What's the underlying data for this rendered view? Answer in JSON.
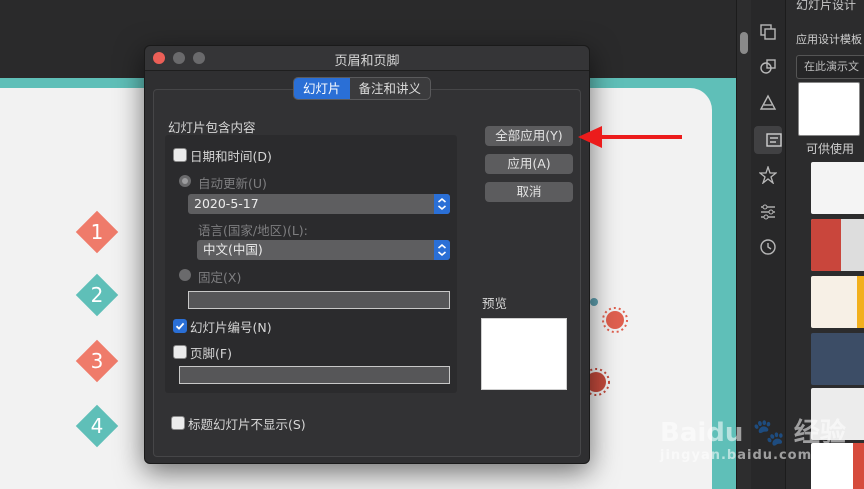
{
  "dialog": {
    "title": "页眉和页脚",
    "tabs": [
      "幻灯片",
      "备注和讲义"
    ],
    "section_title": "幻灯片包含内容",
    "date_time_label": "日期和时间(D)",
    "auto_update_label": "自动更新(U)",
    "date_value": "2020-5-17",
    "language_label": "语言(国家/地区)(L):",
    "language_value": "中文(中国)",
    "fixed_label": "固定(X)",
    "slide_number_label": "幻灯片编号(N)",
    "footer_label": "页脚(F)",
    "hide_on_title_label": "标题幻灯片不显示(S)",
    "buttons": {
      "apply_all": "全部应用(Y)",
      "apply": "应用(A)",
      "cancel": "取消"
    },
    "preview_label": "预览",
    "slide_number_checked": true,
    "date_time_checked": false,
    "footer_checked": false,
    "hide_on_title_checked": false
  },
  "slide": {
    "numbers": [
      "1",
      "2",
      "3",
      "4"
    ]
  },
  "panel": {
    "title": "幻灯片设计",
    "subtitle": "应用设计模板",
    "search_placeholder": "在此演示文",
    "available_label": "可供使用"
  },
  "watermark": {
    "brand": "Baidu",
    "brand_cn": "经验",
    "url": "jingyan.baidu.com"
  },
  "colors": {
    "accent": "#2a6fd6",
    "teal": "#5fbfb8",
    "salmon": "#ef7b6a",
    "arrow": "#ec1c1c"
  },
  "icons": [
    "close-light",
    "minimize-light",
    "zoom-light",
    "chevron-updown-icon",
    "checkmark-icon",
    "arrow-left-icon"
  ]
}
